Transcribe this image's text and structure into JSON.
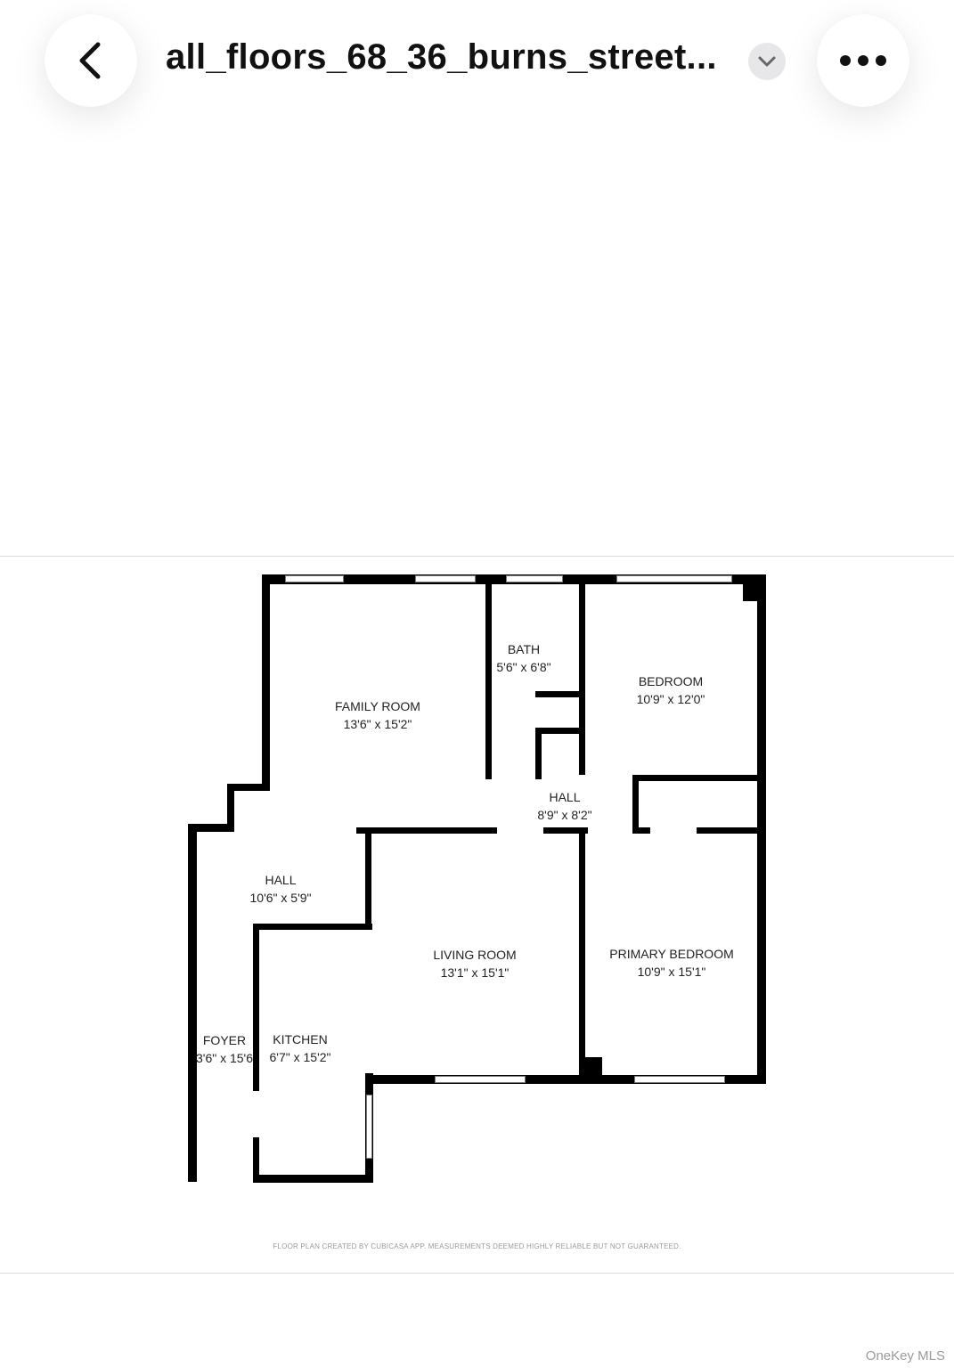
{
  "header": {
    "back_icon": "chevron-left-icon",
    "file_title": "all_floors_68_36_burns_street...",
    "dropdown_icon": "chevron-down-icon",
    "more_icon": "more-horizontal-icon"
  },
  "floor_plan": {
    "rooms": [
      {
        "name": "FAMILY ROOM",
        "dims": "13'6\" x 15'2\""
      },
      {
        "name": "BATH",
        "dims": "5'6\" x 6'8\""
      },
      {
        "name": "BEDROOM",
        "dims": "10'9\" x 12'0\""
      },
      {
        "name": "HALL",
        "dims": "8'9\" x 8'2\""
      },
      {
        "name": "HALL",
        "dims": "10'6\" x 5'9\""
      },
      {
        "name": "LIVING ROOM",
        "dims": "13'1\" x 15'1\""
      },
      {
        "name": "PRIMARY BEDROOM",
        "dims": "10'9\" x 15'1\""
      },
      {
        "name": "FOYER",
        "dims": "3'6\" x 15'6"
      },
      {
        "name": "KITCHEN",
        "dims": "6'7\" x 15'2\""
      }
    ],
    "credit": "FLOOR PLAN CREATED BY CUBICASA APP. MEASUREMENTS DEEMED HIGHLY RELIABLE BUT NOT GUARANTEED."
  },
  "watermark": "OneKey MLS"
}
